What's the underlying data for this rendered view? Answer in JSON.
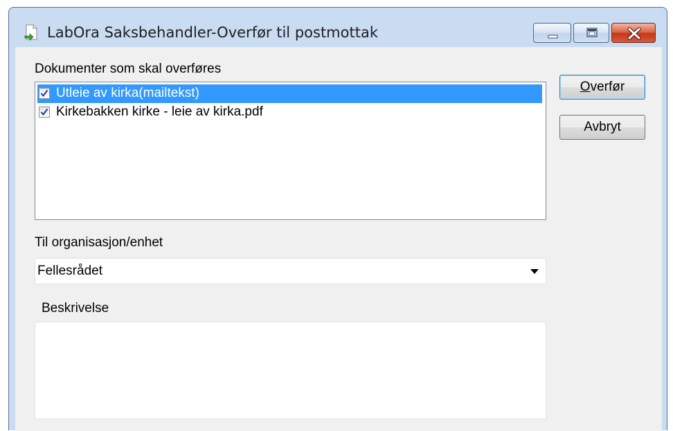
{
  "window": {
    "title": "LabOra Saksbehandler-Overfør til postmottak",
    "icon": "document-arrow-icon",
    "controls": [
      "minimize-icon",
      "maximize-icon",
      "close-icon"
    ]
  },
  "documents": {
    "label": "Dokumenter som skal overføres",
    "items": [
      {
        "label": "Utleie av kirka(mailtekst)",
        "checked": true,
        "selected": true
      },
      {
        "label": "Kirkebakken kirke - leie av kirka.pdf",
        "checked": true,
        "selected": false
      }
    ]
  },
  "buttons": {
    "transfer": {
      "mnemonic": "O",
      "rest": "verfør"
    },
    "cancel": "Avbryt"
  },
  "organization": {
    "label": "Til organisasjon/enhet",
    "value": "Fellesrådet"
  },
  "description": {
    "label": "Beskrivelse",
    "value": ""
  },
  "colors": {
    "selection": "#3399ff",
    "dialog_bg": "#f0f0f0",
    "frame": "#c9dcf1"
  }
}
